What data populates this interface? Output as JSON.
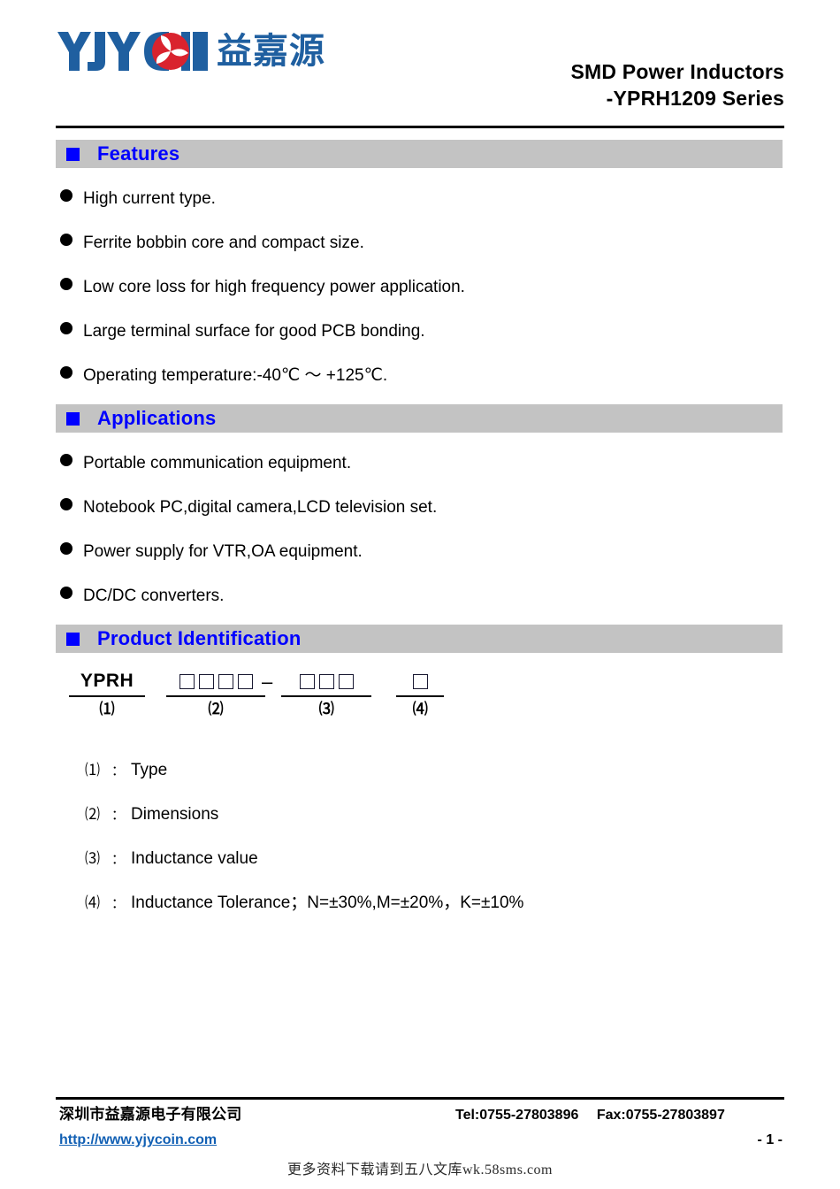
{
  "header": {
    "logo_text": "YJYCOIN",
    "logo_cn": "益嘉源",
    "title_line1": "SMD Power Inductors",
    "title_line2": "-YPRH1209 Series"
  },
  "sections": {
    "features": {
      "heading": "Features",
      "items": [
        "High current type.",
        "Ferrite bobbin core and compact size.",
        "Low core loss for high frequency power application.",
        "Large terminal surface for good PCB bonding.",
        "Operating temperature:-40℃ ～ +125℃."
      ]
    },
    "applications": {
      "heading": "Applications",
      "items": [
        "Portable communication equipment.",
        "Notebook PC,digital camera,LCD television set.",
        "Power supply for VTR,OA equipment.",
        "DC/DC converters."
      ]
    },
    "product_identification": {
      "heading": "Product Identification",
      "diagram": {
        "groups": [
          {
            "code": "YPRH",
            "boxes": 0,
            "label": "⑴"
          },
          {
            "code": "",
            "boxes": 4,
            "label": "⑵"
          },
          {
            "code": "",
            "boxes": 3,
            "label": "⑶"
          },
          {
            "code": "",
            "boxes": 1,
            "label": "⑷"
          }
        ],
        "separator": "–"
      },
      "legend": [
        {
          "num": "⑴",
          "colon": "：",
          "text": "Type"
        },
        {
          "num": "⑵",
          "colon": "：",
          "text": "Dimensions"
        },
        {
          "num": "⑶",
          "colon": "：",
          "text": "Inductance value"
        },
        {
          "num": "⑷",
          "colon": "：",
          "text": "Inductance Tolerance；N=±30%,M=±20%，K=±10%"
        }
      ]
    }
  },
  "footer": {
    "company": "深圳市益嘉源电子有限公司",
    "tel": "Tel:0755-27803896",
    "fax": "Fax:0755-27803897",
    "url": "http://www.yjycoin.com",
    "page": "- 1 -",
    "watermark": "更多资料下载请到五八文库wk.58sms.com"
  },
  "colors": {
    "accent_blue": "#0000ff",
    "band_gray": "#c3c3c3",
    "link_blue": "#1260b4",
    "logo_blue": "#1f5fa0",
    "logo_red": "#d9232e"
  }
}
